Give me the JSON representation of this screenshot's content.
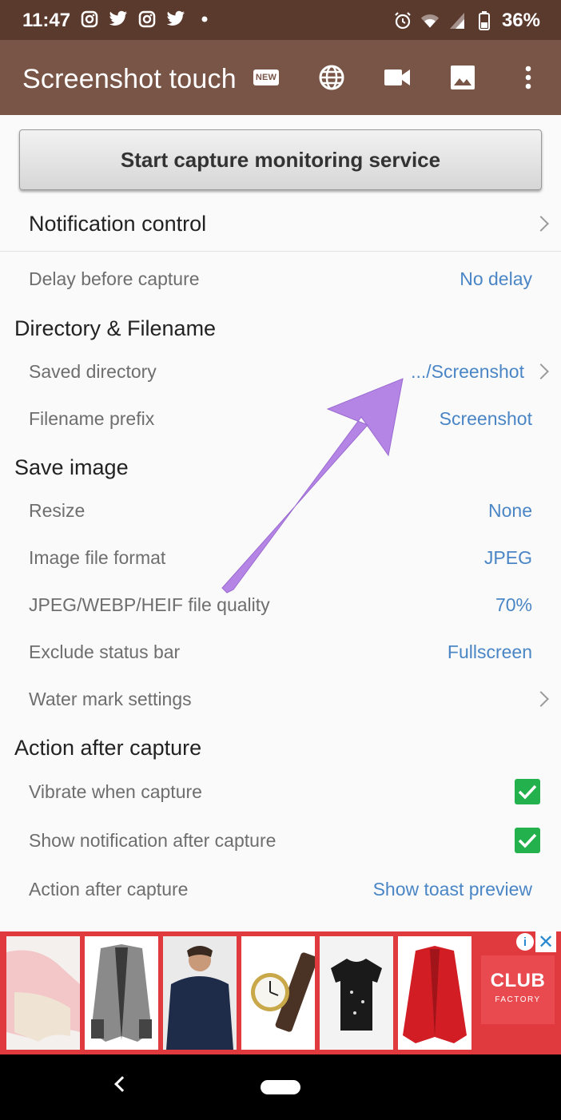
{
  "status_bar": {
    "time": "11:47",
    "battery": "36%",
    "icons": [
      "instagram-icon",
      "twitter-icon",
      "instagram-icon",
      "twitter-icon",
      "dot-icon",
      "alarm-icon",
      "wifi-icon",
      "signal-icon",
      "battery-icon"
    ]
  },
  "app_bar": {
    "title": "Screenshot touch",
    "new_badge": "NEW",
    "actions": [
      "new-icon",
      "globe-icon",
      "video-icon",
      "image-icon",
      "more-vert-icon"
    ]
  },
  "main": {
    "start_button": "Start capture monitoring service",
    "notification_control": "Notification control",
    "delay": {
      "label": "Delay before capture",
      "value": "No delay"
    },
    "sections": {
      "directory": "Directory & Filename",
      "save_image": "Save image",
      "action_after": "Action after capture"
    },
    "saved_directory": {
      "label": "Saved directory",
      "value": ".../Screenshot"
    },
    "filename_prefix": {
      "label": "Filename prefix",
      "value": "Screenshot"
    },
    "resize": {
      "label": "Resize",
      "value": "None"
    },
    "file_format": {
      "label": "Image file format",
      "value": "JPEG"
    },
    "quality": {
      "label": "JPEG/WEBP/HEIF file quality",
      "value": "70%"
    },
    "exclude_status_bar": {
      "label": "Exclude status bar",
      "value": "Fullscreen"
    },
    "watermark": {
      "label": "Water mark settings"
    },
    "vibrate": {
      "label": "Vibrate when capture",
      "checked": true
    },
    "show_notification": {
      "label": "Show notification after capture",
      "checked": true
    },
    "action_after_capture": {
      "label": "Action after capture",
      "value": "Show toast preview"
    }
  },
  "ad": {
    "brand_line1": "CLUB",
    "brand_line2": "FACTORY",
    "info": "i",
    "close": "✕",
    "products": [
      "shorts",
      "cardigan",
      "sweater",
      "watch",
      "t-shirt",
      "red-jacket"
    ]
  },
  "colors": {
    "status_bar": "#5b3a2e",
    "app_bar": "#795548",
    "value_text": "#4a85c5",
    "checkbox": "#22b14c",
    "ad_background": "#e03a3e",
    "annotation_arrow": "#b585e6"
  }
}
